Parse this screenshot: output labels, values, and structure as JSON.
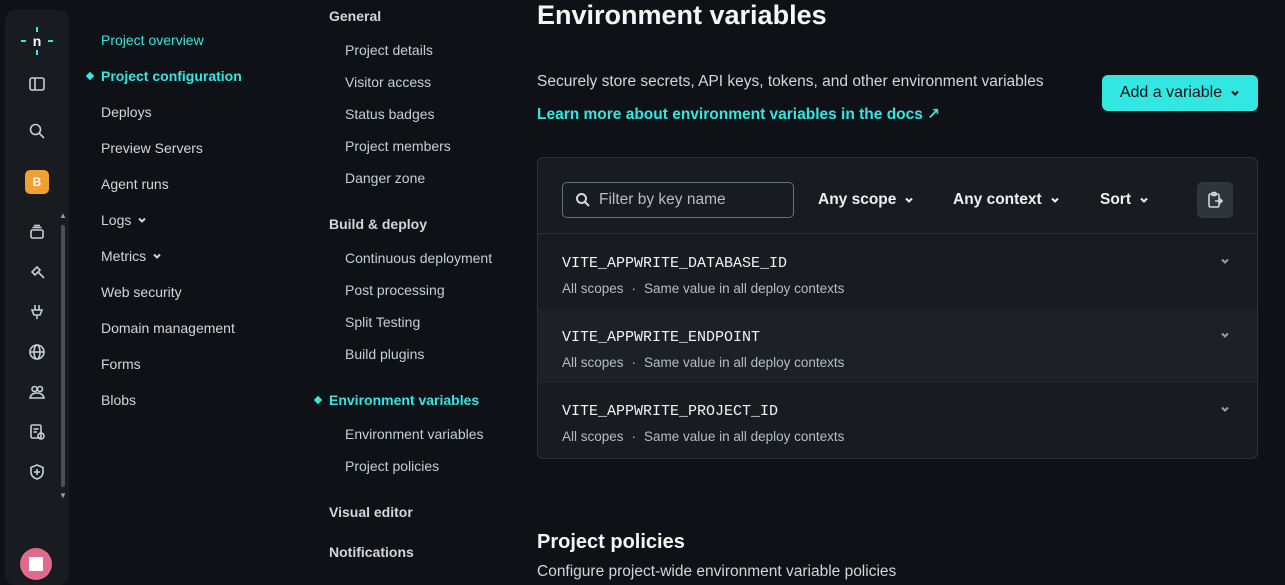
{
  "rail": {
    "icons": [
      "netlify-logo-icon",
      "sidebar-toggle-icon",
      "search-icon",
      "team-badge",
      "layers-icon",
      "hammer-icon",
      "plug-icon",
      "globe-icon",
      "users-icon",
      "audit-log-icon",
      "shield-icon"
    ],
    "team_initial": "B",
    "team_color": "#f0a030",
    "avatar_color": "#e06a8a"
  },
  "project_nav": {
    "items": [
      {
        "label": "Project overview",
        "kind": "link"
      },
      {
        "label": "Project configuration",
        "kind": "active"
      },
      {
        "label": "Deploys"
      },
      {
        "label": "Preview Servers"
      },
      {
        "label": "Agent runs"
      },
      {
        "label": "Logs",
        "expandable": true
      },
      {
        "label": "Metrics",
        "expandable": true
      },
      {
        "label": "Web security"
      },
      {
        "label": "Domain management"
      },
      {
        "label": "Forms"
      },
      {
        "label": "Blobs"
      }
    ]
  },
  "config_nav": {
    "general": "General",
    "general_items": [
      "Project details",
      "Visitor access",
      "Status badges",
      "Project members",
      "Danger zone"
    ],
    "build": "Build & deploy",
    "build_items": [
      "Continuous deployment",
      "Post processing",
      "Split Testing",
      "Build plugins"
    ],
    "env": "Environment variables",
    "env_items": [
      "Environment variables",
      "Project policies"
    ],
    "visual_editor": "Visual editor",
    "notifications": "Notifications"
  },
  "main": {
    "title": "Environment variables",
    "description": "Securely store secrets, API keys, tokens, and other environment variables",
    "docs_link": "Learn more about environment variables in the docs ↗",
    "add_button": "Add a variable",
    "accent_color": "#32e6e2",
    "filter": {
      "placeholder": "Filter by key name",
      "scope": "Any scope",
      "context": "Any context",
      "sort": "Sort"
    },
    "variables": [
      {
        "key": "VITE_APPWRITE_DATABASE_ID",
        "scopes": "All scopes",
        "contexts": "Same value in all deploy contexts"
      },
      {
        "key": "VITE_APPWRITE_ENDPOINT",
        "scopes": "All scopes",
        "contexts": "Same value in all deploy contexts"
      },
      {
        "key": "VITE_APPWRITE_PROJECT_ID",
        "scopes": "All scopes",
        "contexts": "Same value in all deploy contexts"
      }
    ],
    "policies_title": "Project policies",
    "policies_description": "Configure project-wide environment variable policies"
  }
}
